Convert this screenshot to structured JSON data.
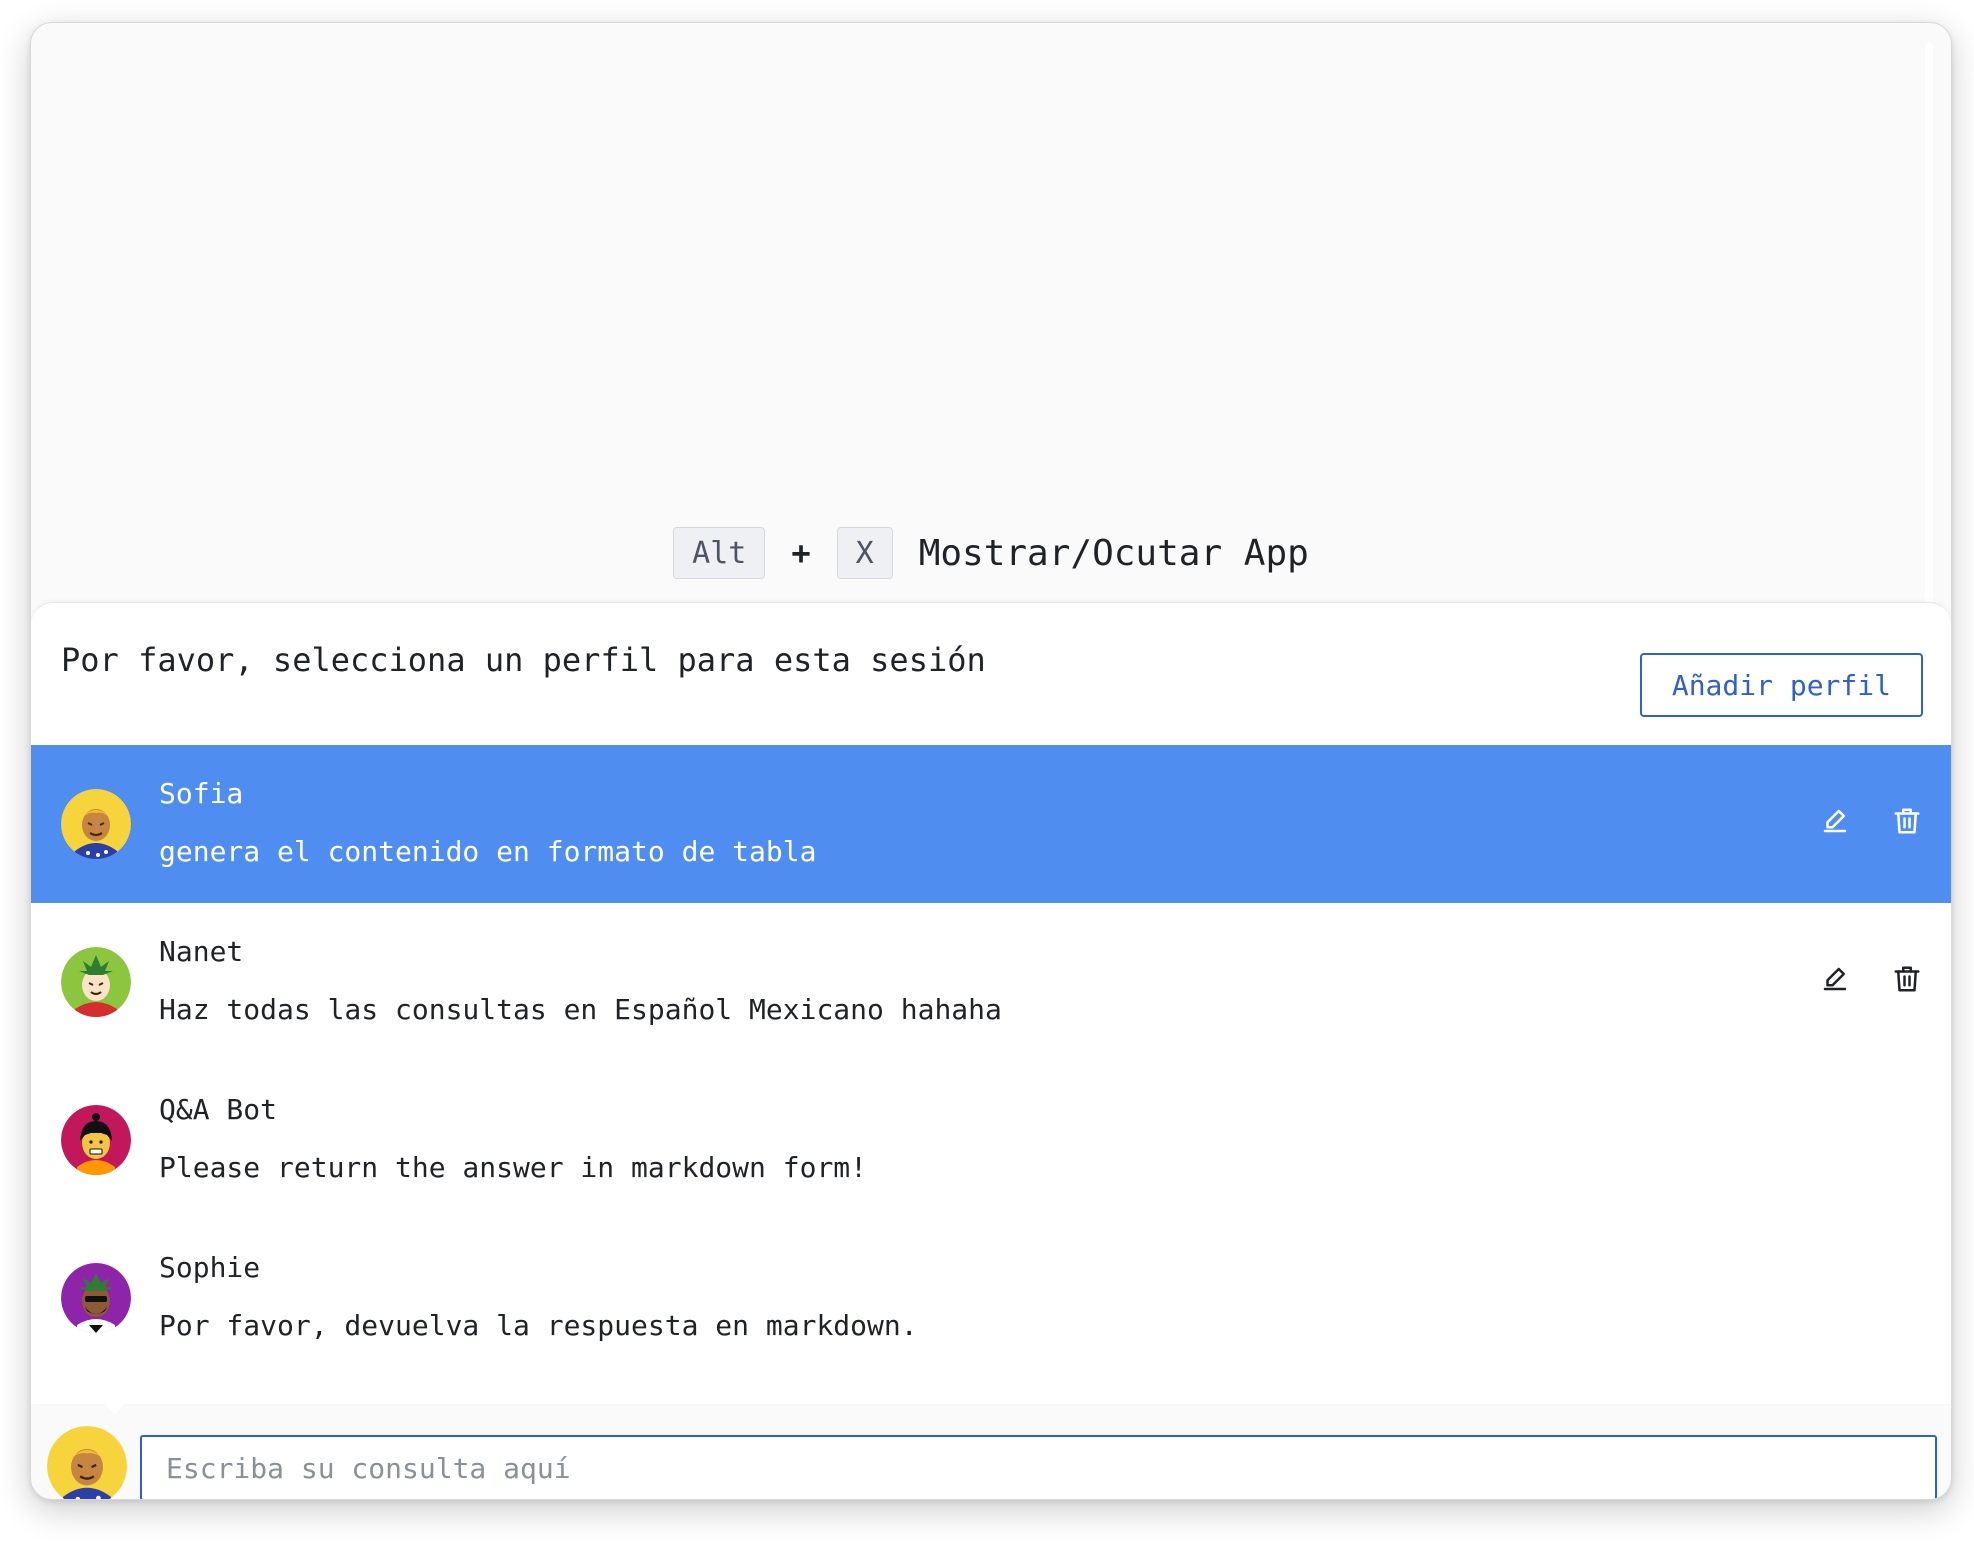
{
  "shortcut": {
    "key1": "Alt",
    "plus": "+",
    "key2": "X",
    "label": "Mostrar/Ocutar App"
  },
  "panel": {
    "title": "Por favor, selecciona un perfil para esta sesión",
    "add_button": "Añadir perfil"
  },
  "profiles": [
    {
      "name": "Sofia",
      "description": "genera el contenido en formato de tabla",
      "selected": true,
      "avatar_bg": "#f7d43c"
    },
    {
      "name": "Nanet",
      "description": "Haz todas las consultas en Español Mexicano hahaha",
      "selected": false,
      "avatar_bg": "#8cc63f"
    },
    {
      "name": "Q&A Bot",
      "description": "Please return the answer in markdown form!",
      "selected": false,
      "avatar_bg": "#c2185b"
    },
    {
      "name": "Sophie",
      "description": "Por favor, devuelva la respuesta en markdown.",
      "selected": false,
      "avatar_bg": "#8e24aa"
    }
  ],
  "input": {
    "placeholder": "Escriba su consulta aquí"
  },
  "icons": {
    "edit": "pencil-icon",
    "delete": "trash-icon"
  },
  "colors": {
    "selected_row": "#4f8ef0",
    "accent": "#2f5fd7"
  }
}
